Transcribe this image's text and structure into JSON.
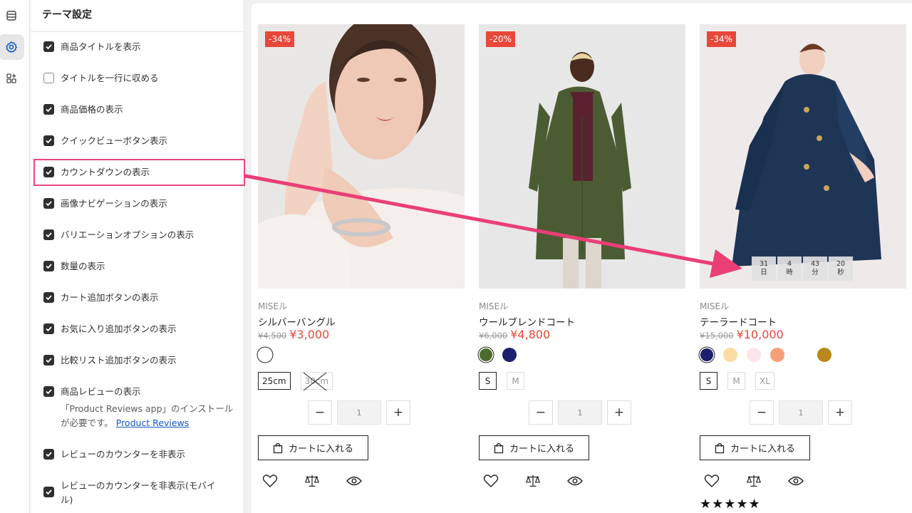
{
  "panel": {
    "title": "テーマ設定",
    "options": [
      {
        "label": "商品タイトルを表示",
        "checked": true
      },
      {
        "label": "タイトルを一行に収める",
        "checked": false
      },
      {
        "label": "商品価格の表示",
        "checked": true
      },
      {
        "label": "クイックビューボタン表示",
        "checked": true
      },
      {
        "label": "カウントダウンの表示",
        "checked": true
      },
      {
        "label": "画像ナビゲーションの表示",
        "checked": true
      },
      {
        "label": "バリエーションオプションの表示",
        "checked": true
      },
      {
        "label": "数量の表示",
        "checked": true
      },
      {
        "label": "カート追加ボタンの表示",
        "checked": true
      },
      {
        "label": "お気に入り追加ボタンの表示",
        "checked": true
      },
      {
        "label": "比較リスト追加ボタンの表示",
        "checked": true
      },
      {
        "label": "商品レビューの表示",
        "checked": true
      },
      {
        "label": "レビューのカウンターを非表示",
        "checked": true
      },
      {
        "label": "レビューのカウンターを非表示(モバイル)",
        "checked": true
      }
    ],
    "reviews_help_text": "「Product Reviews app」のインストールが必要です。",
    "reviews_help_link": "Product Reviews"
  },
  "rail": {
    "icons": [
      "sections-icon",
      "settings-gear-icon",
      "apps-icon"
    ]
  },
  "products": [
    {
      "badge": "-34%",
      "vendor": "MISEル",
      "title": "シルバーバングル",
      "old_price": "¥4,500",
      "price": "¥3,000",
      "swatches": [
        {
          "color": "#ffffff",
          "selected": true
        }
      ],
      "sizes": [
        {
          "label": "25cm",
          "selected": true,
          "available": true
        },
        {
          "label": "30cm",
          "selected": false,
          "available": false
        }
      ],
      "quantity": "1",
      "cart_label": "カートに入れる"
    },
    {
      "badge": "-20%",
      "vendor": "MISEル",
      "title": "ウールブレンドコート",
      "old_price": "¥6,000",
      "price": "¥4,800",
      "swatches": [
        {
          "color": "#4d6b2e",
          "selected": true
        },
        {
          "color": "#1b1f6e",
          "selected": false
        }
      ],
      "sizes": [
        {
          "label": "S",
          "selected": true,
          "available": true
        },
        {
          "label": "M",
          "selected": false,
          "available": true
        }
      ],
      "quantity": "1",
      "cart_label": "カートに入れる"
    },
    {
      "badge": "-34%",
      "vendor": "MISEル",
      "title": "テーラードコート",
      "old_price": "¥15,000",
      "price": "¥10,000",
      "swatches": [
        {
          "color": "#1b1f6e",
          "selected": true
        },
        {
          "color": "#fcdca0",
          "selected": false
        },
        {
          "color": "#fbe4ea",
          "selected": false
        },
        {
          "color": "#f6a07a",
          "selected": false
        },
        {
          "color": "#ffffff",
          "selected": false
        },
        {
          "color": "#b8891a",
          "selected": false
        }
      ],
      "sizes": [
        {
          "label": "S",
          "selected": true,
          "available": true
        },
        {
          "label": "M",
          "selected": false,
          "available": true
        },
        {
          "label": "XL",
          "selected": false,
          "available": true
        }
      ],
      "quantity": "1",
      "cart_label": "カートに入れる",
      "countdown": [
        {
          "num": "31",
          "unit": "日"
        },
        {
          "num": "4",
          "unit": "時"
        },
        {
          "num": "43",
          "unit": "分"
        },
        {
          "num": "20",
          "unit": "秒"
        }
      ],
      "stars": "★★★★★"
    }
  ],
  "colors": {
    "accent_red": "#e8473a",
    "highlight_pink": "#e8497a"
  }
}
